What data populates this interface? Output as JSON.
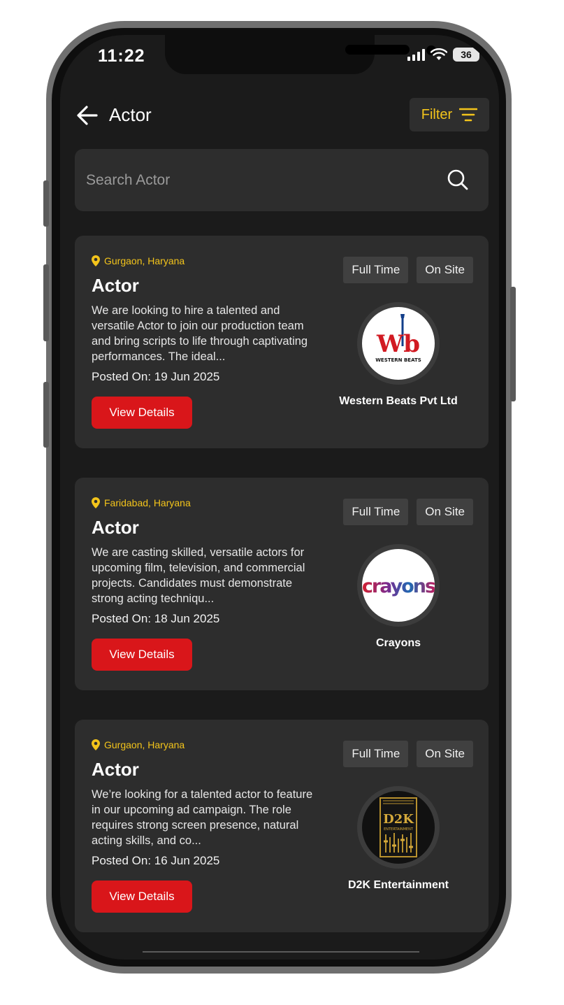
{
  "status_bar": {
    "time": "11:22",
    "battery": "36"
  },
  "header": {
    "title": "Actor",
    "filter_label": "Filter"
  },
  "search": {
    "placeholder": "Search Actor"
  },
  "jobs": [
    {
      "location": "Gurgaon, Haryana",
      "title": "Actor",
      "description": "We are looking to hire a talented and versatile Actor to join our production team and bring scripts to life through captivating performances. The ideal...",
      "posted": "Posted On: 19 Jun 2025",
      "tags": [
        "Full Time",
        "On Site"
      ],
      "company": "Western Beats Pvt Ltd",
      "logo_text": "Wb",
      "logo_sub": "WESTERN BEATS",
      "button": "View Details"
    },
    {
      "location": "Faridabad, Haryana",
      "title": "Actor",
      "description": "We are casting skilled, versatile actors for upcoming film, television, and commercial projects. Candidates must demonstrate strong acting techniqu...",
      "posted": "Posted On: 18 Jun 2025",
      "tags": [
        "Full Time",
        "On Site"
      ],
      "company": "Crayons",
      "logo_text": "crayons",
      "button": "View Details"
    },
    {
      "location": "Gurgaon, Haryana",
      "title": "Actor",
      "description": "We’re looking for a talented actor to feature in our upcoming ad campaign. The role requires strong screen presence, natural acting skills, and co...",
      "posted": "Posted On: 16 Jun 2025",
      "tags": [
        "Full Time",
        "On Site"
      ],
      "company": "D2K Entertainment",
      "logo_text": "D2K",
      "logo_sub": "ENTERTAINMENT",
      "button": "View Details"
    }
  ],
  "colors": {
    "accent": "#f3c41b",
    "button": "#d9161a",
    "card": "#2d2d2d",
    "background": "#1b1b1b"
  }
}
